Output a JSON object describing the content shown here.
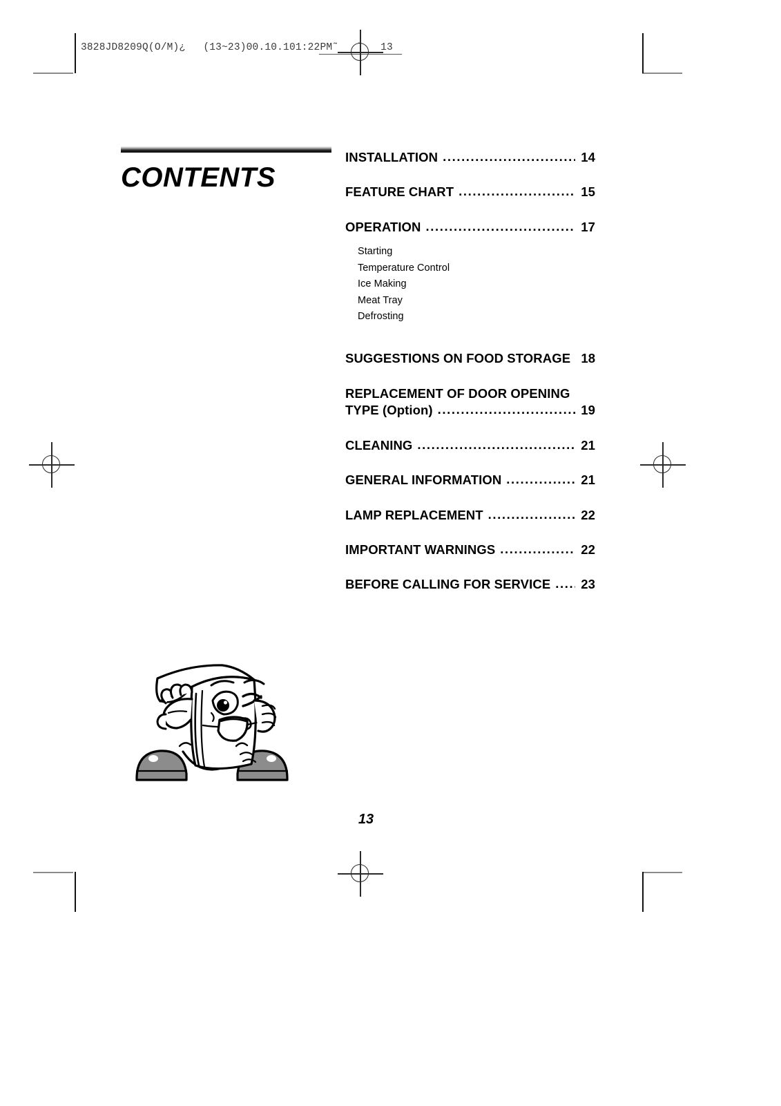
{
  "print_header": {
    "job_code": "3828JD8209Q(O/M)¿",
    "range_timestamp": "(13~23)00.10.101:22PM˜",
    "tail_mark": "`",
    "folio": "13"
  },
  "heading": {
    "title": "CONTENTS"
  },
  "toc": {
    "entries": [
      {
        "label": "INSTALLATION",
        "leader": "........................................",
        "page": "14",
        "sub_items": []
      },
      {
        "label": "FEATURE CHART",
        "leader": "....................................",
        "page": "15",
        "sub_items": []
      },
      {
        "label": "OPERATION",
        "leader": "..............................................",
        "page": "17",
        "sub_items": [
          "Starting",
          "Temperature Control",
          "Ice Making",
          "Meat Tray",
          "Defrosting"
        ]
      },
      {
        "label": "SUGGESTIONS ON FOOD STORAGE",
        "leader": "....",
        "page": "18",
        "sub_items": []
      },
      {
        "label": "REPLACEMENT OF DOOR OPENING",
        "label_line2": "TYPE (Option)",
        "leader": ".........................................",
        "page": "19",
        "sub_items": []
      },
      {
        "label": "CLEANING",
        "leader": "..............................................",
        "page": "21",
        "sub_items": []
      },
      {
        "label": "GENERAL INFORMATION",
        "leader": ".......................",
        "page": "21",
        "sub_items": []
      },
      {
        "label": "LAMP REPLACEMENT",
        "leader": "............................",
        "page": "22",
        "sub_items": []
      },
      {
        "label": "IMPORTANT WARNINGS",
        "leader": "........................",
        "page": "22",
        "sub_items": []
      },
      {
        "label": "BEFORE CALLING FOR SERVICE",
        "leader": ".........",
        "page": "23",
        "sub_items": []
      }
    ]
  },
  "illustration": {
    "name": "refrigerator-mascot",
    "description": "Cartoon refrigerator character winking and waving",
    "shoe_color": "#8c8c8c",
    "outline_color": "#000000"
  },
  "footer": {
    "page_number": "13"
  }
}
